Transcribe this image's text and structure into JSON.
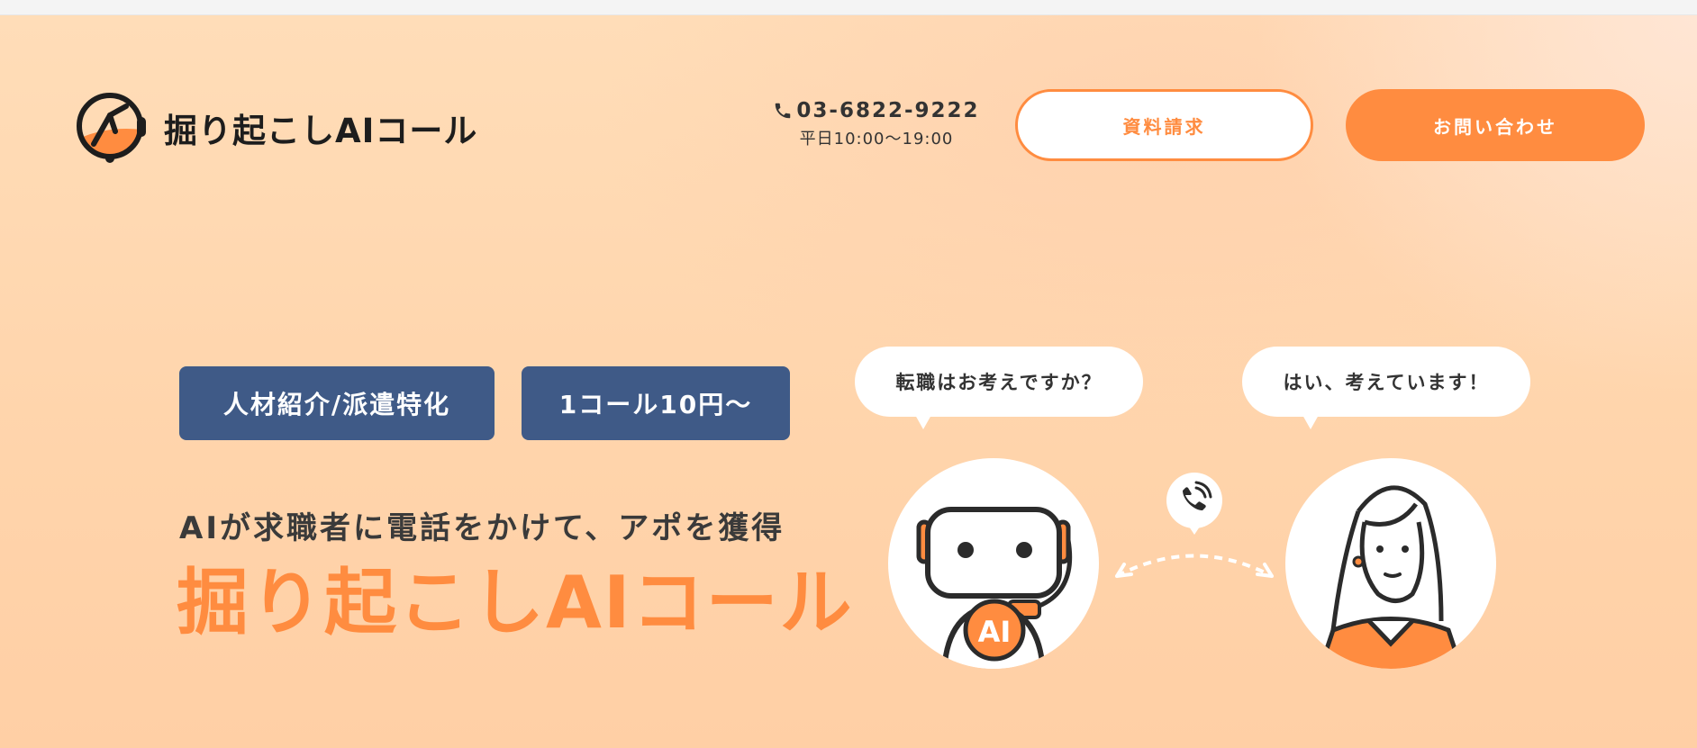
{
  "logo": {
    "text": "掘り起こしAIコール"
  },
  "contact": {
    "phone": "03-6822-9222",
    "hours": "平日10:00〜19:00",
    "doc_button": "資料請求",
    "contact_button": "お問い合わせ"
  },
  "hero": {
    "tags": [
      "人材紹介/派遣特化",
      "1コール10円〜"
    ],
    "lead": "AIが求職者に電話をかけて、アポを獲得",
    "headline": "掘り起こしAIコール",
    "bubbles": [
      "転職はお考えですか？",
      "はい、考えています！"
    ],
    "robot_badge": "AI"
  },
  "colors": {
    "accent": "#ff8c40",
    "tag_bg": "#3f5a87",
    "text_dark": "#333333"
  }
}
